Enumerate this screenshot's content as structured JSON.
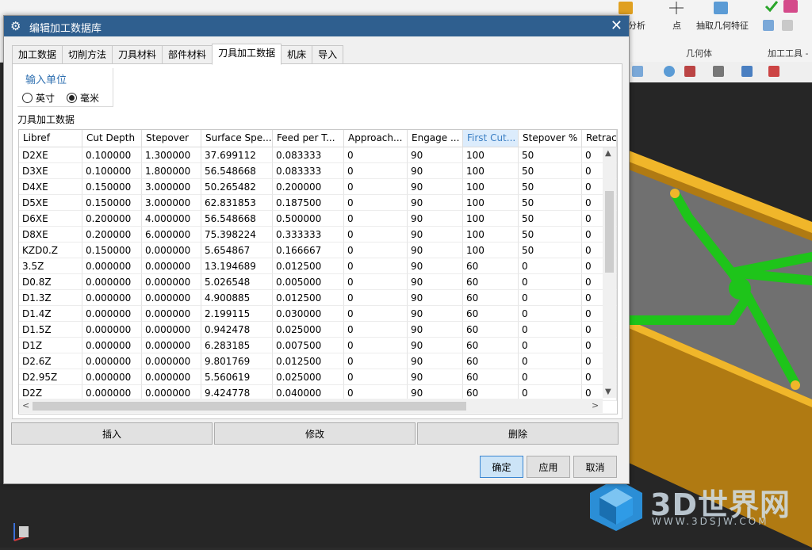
{
  "background": {
    "toolbar_labels": [
      "分析",
      "点",
      "抽取几何特征"
    ],
    "group_labels": [
      "几何体",
      "加工工具 -"
    ],
    "watermark": {
      "brand": "3D世界网",
      "url": "WWW.3DSJW.COM"
    }
  },
  "dialog": {
    "title": "编辑加工数据库",
    "tabs": [
      {
        "label": "加工数据",
        "active": false
      },
      {
        "label": "切削方法",
        "active": false
      },
      {
        "label": "刀具材料",
        "active": false
      },
      {
        "label": "部件材料",
        "active": false
      },
      {
        "label": "刀具加工数据",
        "active": true
      },
      {
        "label": "机床",
        "active": false
      },
      {
        "label": "导入",
        "active": false
      }
    ],
    "units": {
      "legend": "输入单位",
      "options": [
        {
          "label": "英寸",
          "selected": false
        },
        {
          "label": "毫米",
          "selected": true
        }
      ]
    },
    "section_label": "刀具加工数据",
    "table": {
      "columns": [
        "Libref",
        "Cut Depth",
        "Stepover",
        "Surface Spe...",
        "Feed per T...",
        "Approach...",
        "Engage ...",
        "First Cut...",
        "Stepover %",
        "Retrac"
      ],
      "rows": [
        [
          "D2XE",
          "0.100000",
          "1.300000",
          "37.699112",
          "0.083333",
          "0",
          "90",
          "100",
          "50",
          "0"
        ],
        [
          "D3XE",
          "0.100000",
          "1.800000",
          "56.548668",
          "0.083333",
          "0",
          "90",
          "100",
          "50",
          "0"
        ],
        [
          "D4XE",
          "0.150000",
          "3.000000",
          "50.265482",
          "0.200000",
          "0",
          "90",
          "100",
          "50",
          "0"
        ],
        [
          "D5XE",
          "0.150000",
          "3.000000",
          "62.831853",
          "0.187500",
          "0",
          "90",
          "100",
          "50",
          "0"
        ],
        [
          "D6XE",
          "0.200000",
          "4.000000",
          "56.548668",
          "0.500000",
          "0",
          "90",
          "100",
          "50",
          "0"
        ],
        [
          "D8XE",
          "0.200000",
          "6.000000",
          "75.398224",
          "0.333333",
          "0",
          "90",
          "100",
          "50",
          "0"
        ],
        [
          "KZD0.Z",
          "0.150000",
          "0.000000",
          "5.654867",
          "0.166667",
          "0",
          "90",
          "100",
          "50",
          "0"
        ],
        [
          "3.5Z",
          "0.000000",
          "0.000000",
          "13.194689",
          "0.012500",
          "0",
          "90",
          "60",
          "0",
          "0"
        ],
        [
          "D0.8Z",
          "0.000000",
          "0.000000",
          "5.026548",
          "0.005000",
          "0",
          "90",
          "60",
          "0",
          "0"
        ],
        [
          "D1.3Z",
          "0.000000",
          "0.000000",
          "4.900885",
          "0.012500",
          "0",
          "90",
          "60",
          "0",
          "0"
        ],
        [
          "D1.4Z",
          "0.000000",
          "0.000000",
          "2.199115",
          "0.030000",
          "0",
          "90",
          "60",
          "0",
          "0"
        ],
        [
          "D1.5Z",
          "0.000000",
          "0.000000",
          "0.942478",
          "0.025000",
          "0",
          "90",
          "60",
          "0",
          "0"
        ],
        [
          "D1Z",
          "0.000000",
          "0.000000",
          "6.283185",
          "0.007500",
          "0",
          "90",
          "60",
          "0",
          "0"
        ],
        [
          "D2.6Z",
          "0.000000",
          "0.000000",
          "9.801769",
          "0.012500",
          "0",
          "90",
          "60",
          "0",
          "0"
        ],
        [
          "D2.95Z",
          "0.000000",
          "0.000000",
          "5.560619",
          "0.025000",
          "0",
          "90",
          "60",
          "0",
          "0"
        ],
        [
          "D2Z",
          "0.000000",
          "0.000000",
          "9.424778",
          "0.040000",
          "0",
          "90",
          "60",
          "0",
          "0"
        ]
      ]
    },
    "action_buttons": {
      "insert": "插入",
      "modify": "修改",
      "delete": "删除"
    },
    "footer_buttons": {
      "ok": "确定",
      "apply": "应用",
      "cancel": "取消"
    }
  },
  "colors": {
    "title_bar": "#2f5f8f",
    "accent": "#3b86d1",
    "part_green": "#22c41a",
    "part_orange": "#e8a317"
  }
}
